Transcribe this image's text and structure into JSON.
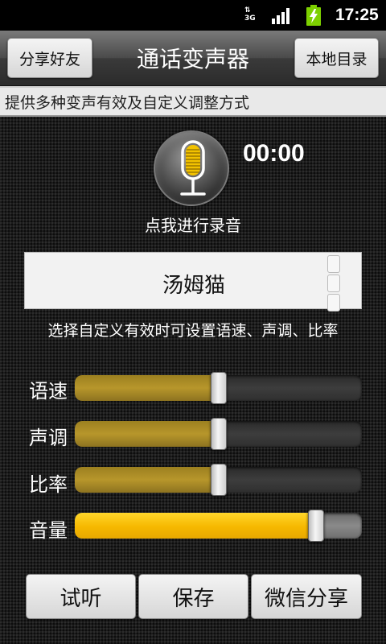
{
  "status_bar": {
    "network": "3G",
    "time": "17:25",
    "icons": [
      "3g-data-icon",
      "signal-icon",
      "battery-charging-icon"
    ]
  },
  "header": {
    "share_button": "分享好友",
    "title": "通话变声器",
    "local_dir_button": "本地目录"
  },
  "tip_text": "提供多种变声有效及自定义调整方式",
  "recorder": {
    "icon": "microphone-icon",
    "timer": "00:00",
    "label": "点我进行录音"
  },
  "voice_selector": {
    "selected": "汤姆猫"
  },
  "hint_text": "选择自定义有效时可设置语速、声调、比率",
  "sliders": [
    {
      "label": "语速",
      "value": 0.5
    },
    {
      "label": "声调",
      "value": 0.5
    },
    {
      "label": "比率",
      "value": 0.5
    },
    {
      "label": "音量",
      "value": 0.84
    }
  ],
  "footer": {
    "preview_button": "试听",
    "save_button": "保存",
    "wechat_share_button": "微信分享"
  },
  "colors": {
    "slider_fill": "#b0902a",
    "volume_fill": "#f6b800",
    "mic_accent": "#f2c200"
  }
}
